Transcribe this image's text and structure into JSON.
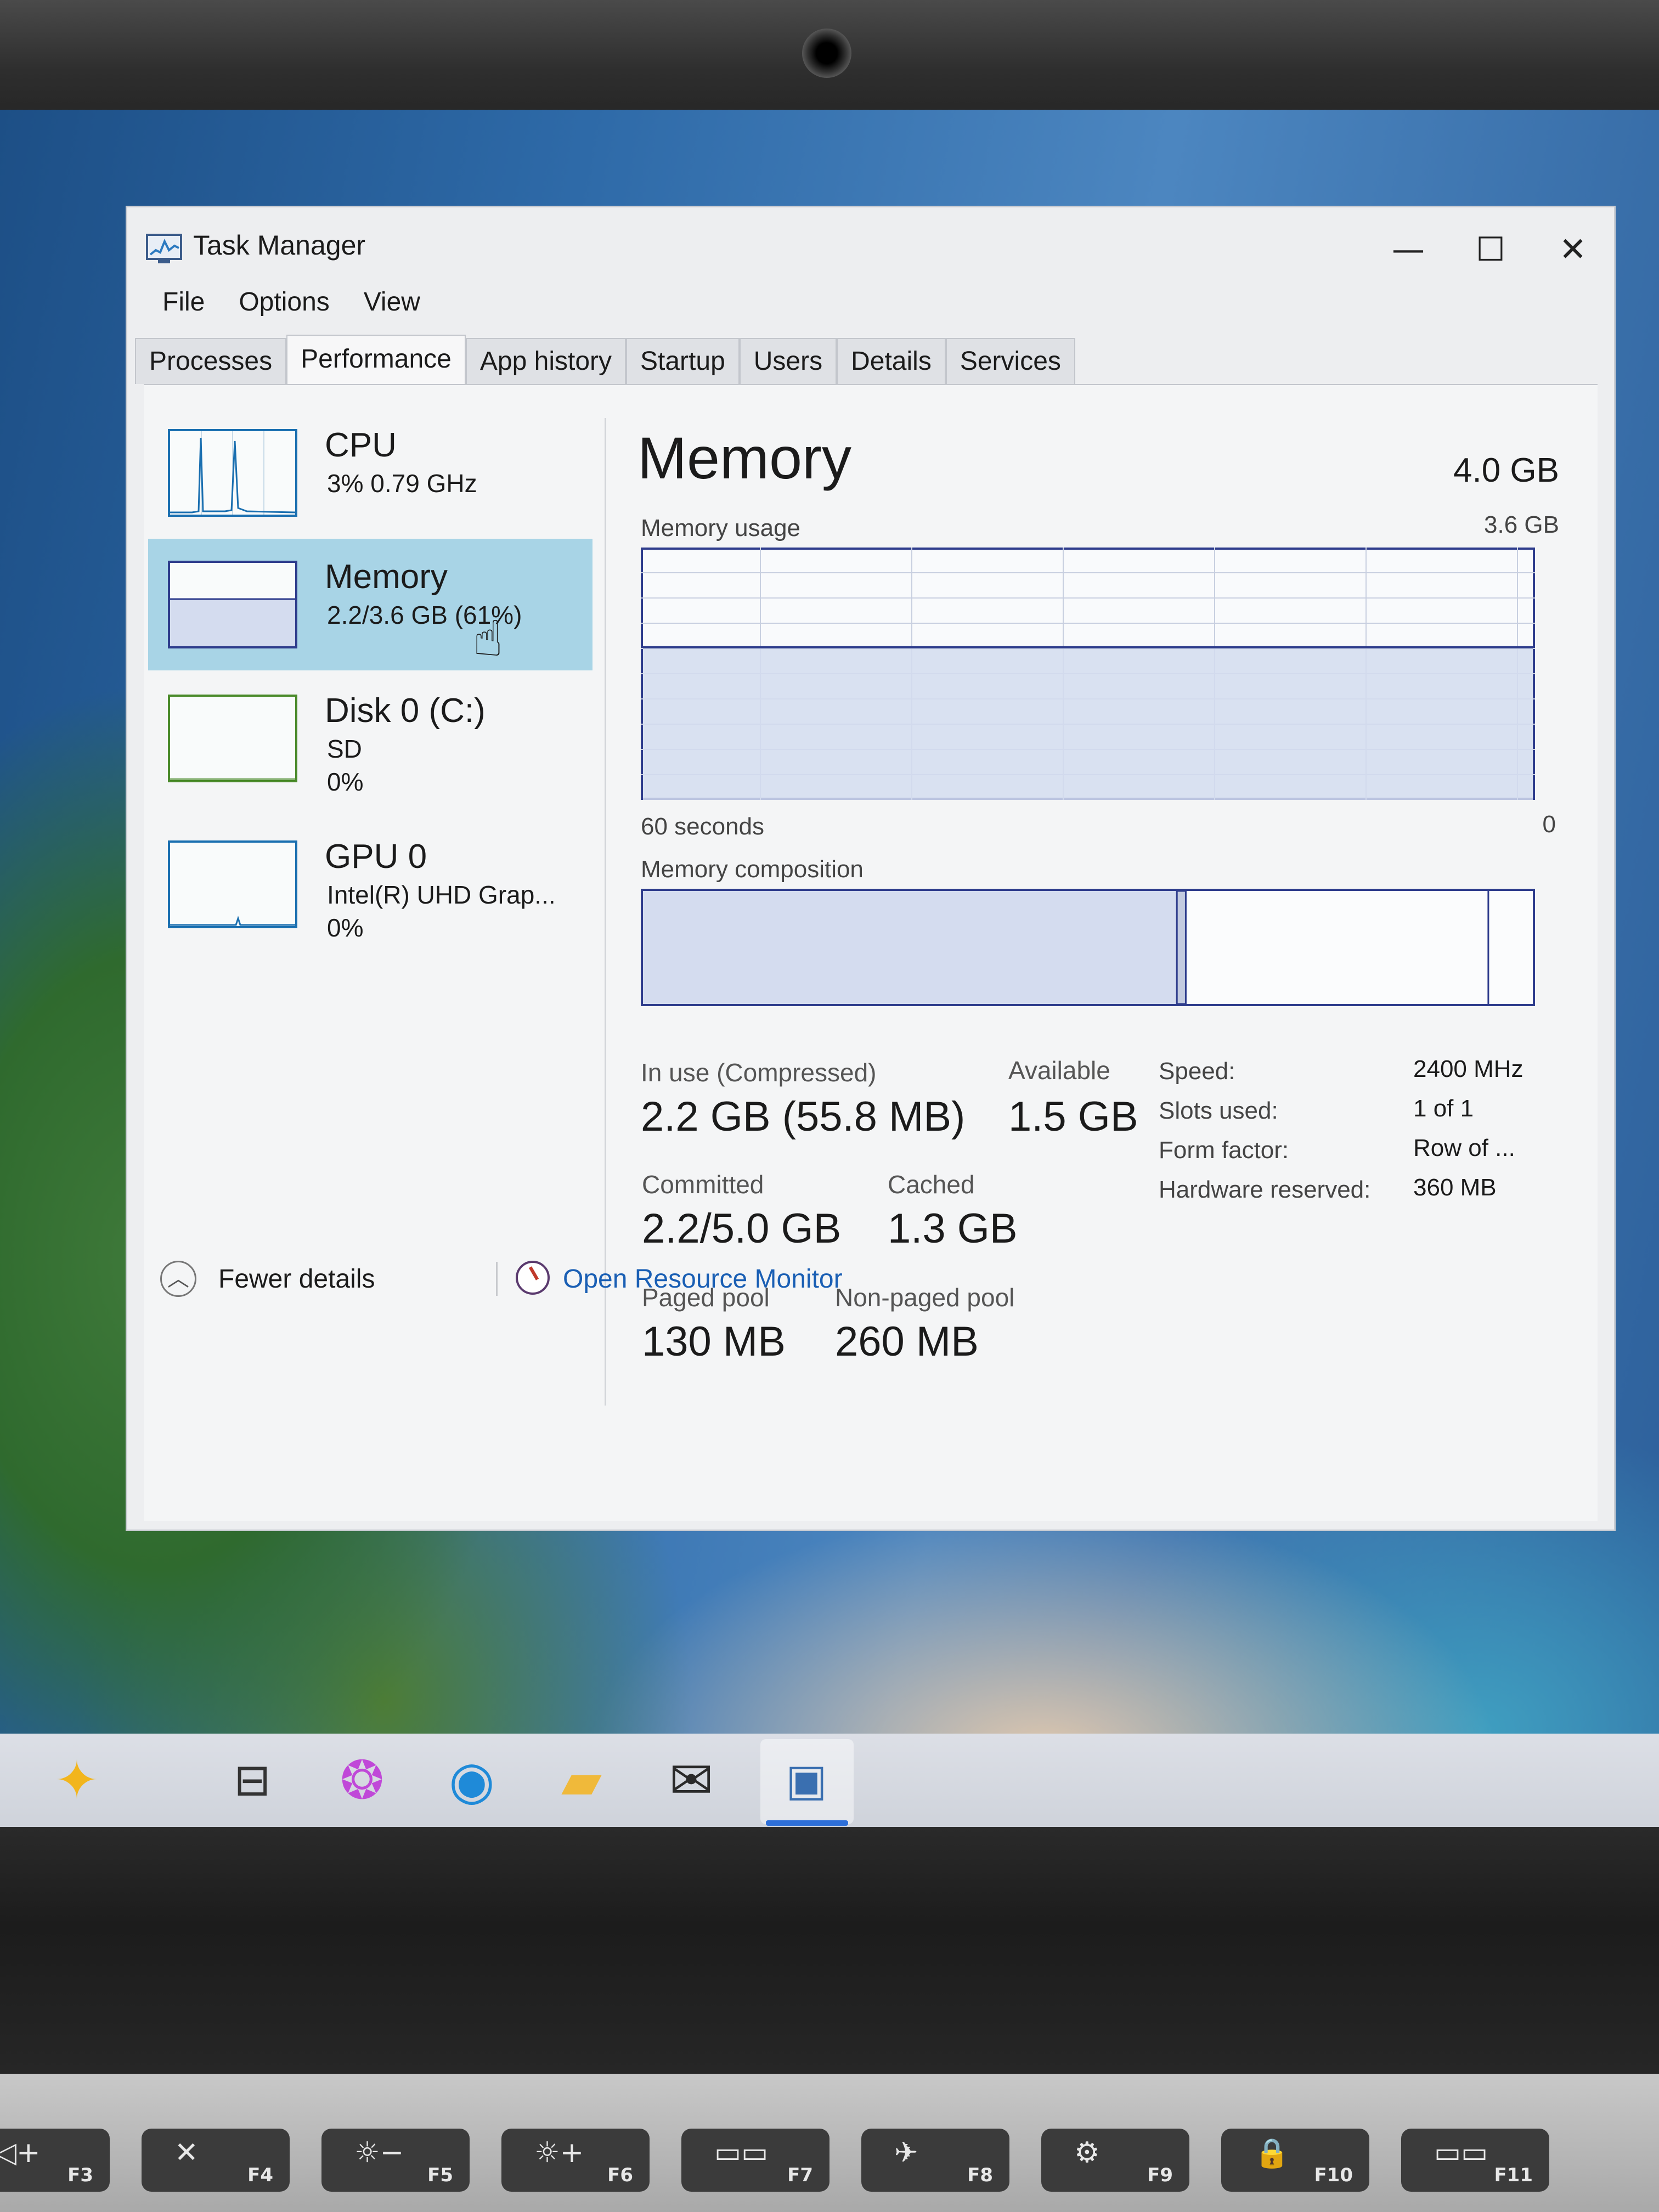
{
  "window": {
    "title": "Task Manager",
    "controls": {
      "minimize": "—",
      "maximize": "☐",
      "close": "✕"
    }
  },
  "menu": [
    "File",
    "Options",
    "View"
  ],
  "tabs": [
    {
      "label": "Processes",
      "active": false
    },
    {
      "label": "Performance",
      "active": true
    },
    {
      "label": "App history",
      "active": false
    },
    {
      "label": "Startup",
      "active": false
    },
    {
      "label": "Users",
      "active": false
    },
    {
      "label": "Details",
      "active": false
    },
    {
      "label": "Services",
      "active": false
    }
  ],
  "sidebar": {
    "items": [
      {
        "name": "CPU",
        "line1": "3%  0.79 GHz",
        "line2": "",
        "selected": false
      },
      {
        "name": "Memory",
        "line1": "2.2/3.6 GB (61%)",
        "line2": "",
        "selected": true
      },
      {
        "name": "Disk 0 (C:)",
        "line1": "SD",
        "line2": "0%",
        "selected": false
      },
      {
        "name": "GPU 0",
        "line1": "Intel(R) UHD Grap...",
        "line2": "0%",
        "selected": false
      }
    ]
  },
  "main": {
    "title": "Memory",
    "total": "4.0 GB",
    "usage_label": "Memory usage",
    "usage_max": "3.6 GB",
    "usage_level": 0.61,
    "axis_left": "60 seconds",
    "axis_right": "0",
    "composition_label": "Memory composition",
    "composition": {
      "in_use_fraction": 0.6,
      "modified_fraction": 0.01,
      "standby_fraction": 0.34,
      "free_fraction": 0.05
    },
    "stats": {
      "in_use_label": "In use (Compressed)",
      "in_use_value": "2.2 GB (55.8 MB)",
      "available_label": "Available",
      "available_value": "1.5 GB",
      "committed_label": "Committed",
      "committed_value": "2.2/5.0 GB",
      "cached_label": "Cached",
      "cached_value": "1.3 GB",
      "paged_label": "Paged pool",
      "paged_value": "130 MB",
      "nonpaged_label": "Non-paged pool",
      "nonpaged_value": "260 MB"
    },
    "specs": [
      {
        "label": "Speed:",
        "value": "2400 MHz"
      },
      {
        "label": "Slots used:",
        "value": "1 of 1"
      },
      {
        "label": "Form factor:",
        "value": "Row of ..."
      },
      {
        "label": "Hardware reserved:",
        "value": "360 MB"
      }
    ]
  },
  "footer": {
    "fewer_details": "Fewer details",
    "resource_monitor": "Open Resource Monitor"
  },
  "taskbar": {
    "icons": [
      "copilot-sparkle-icon",
      "task-view-icon",
      "copilot-icon",
      "edge-icon",
      "file-explorer-icon",
      "mail-icon",
      "task-manager-icon"
    ]
  },
  "colors": {
    "accent": "#1a6fb0",
    "selected_bg": "#a8d4e6",
    "graph_line": "#2e3c8c",
    "graph_fill": "#d4dcef",
    "link": "#1a5fb4"
  },
  "keyboard": {
    "keys": [
      {
        "icon": "◁+",
        "fn": "F3"
      },
      {
        "icon": "✕",
        "fn": "F4"
      },
      {
        "icon": "☼−",
        "fn": "F5"
      },
      {
        "icon": "☼+",
        "fn": "F6"
      },
      {
        "icon": "▭▭",
        "fn": "F7"
      },
      {
        "icon": "✈",
        "fn": "F8"
      },
      {
        "icon": "⚙",
        "fn": "F9"
      },
      {
        "icon": "🔒",
        "fn": "F10"
      },
      {
        "icon": "▭▭",
        "fn": "F11"
      }
    ]
  }
}
